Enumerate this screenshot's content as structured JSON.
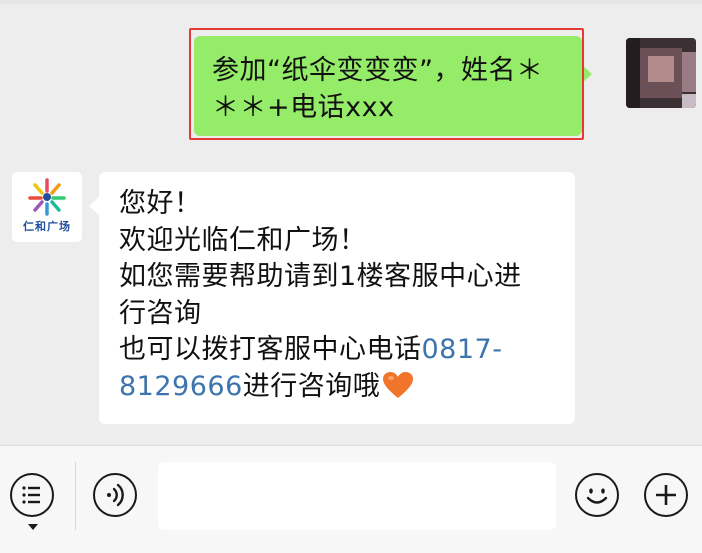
{
  "conversation": {
    "outgoing": {
      "lines": [
        "参加“纸伞变变变”，姓名＊",
        "＊＊+电话xxx"
      ]
    },
    "incoming": {
      "sender_logo_text": "仁和广场",
      "lines": [
        "您好！",
        "欢迎光临仁和广场！",
        "如您需要帮助请到1楼客服中心进",
        "行咨询",
        "也可以拨打客服中心电话"
      ],
      "phone_part1": "0817-",
      "phone_part2": "8129666",
      "closing": "进行咨询哦"
    }
  },
  "colors": {
    "outgoing_bubble": "#95ec69",
    "incoming_bubble": "#ffffff",
    "highlight": "#e53935",
    "link": "#3d74ad",
    "background": "#ededed"
  },
  "icons": {
    "menu": "list-menu-icon",
    "voice": "voice-icon",
    "emoji": "smiley-icon",
    "plus": "plus-icon",
    "heart": "heart-emoji"
  }
}
